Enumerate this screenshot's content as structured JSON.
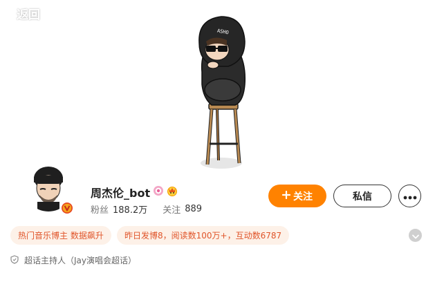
{
  "header": {
    "back_label": "返回",
    "back_icon": "chevron-left-icon"
  },
  "profile": {
    "name": "周杰伦_bot",
    "followers_label": "粉丝",
    "followers_value": "188.2万",
    "following_label": "关注",
    "following_value": "889",
    "badges": [
      "music-badge-icon",
      "crown-badge-icon"
    ],
    "verified_icon": "verified-v-icon"
  },
  "actions": {
    "follow_label": "关注",
    "follow_icon": "plus-icon",
    "message_label": "私信",
    "more_icon": "more-dots-icon"
  },
  "tags": [
    {
      "label": "热门音乐博主 数据飙升"
    },
    {
      "label": "昨日发博8，阅读数100万+，互动数6787"
    }
  ],
  "role": {
    "icon": "shield-icon",
    "label": "超话主持人（Jay演唱会超话）"
  },
  "colors": {
    "accent": "#ff8200",
    "tag_bg": "#fdf1e8",
    "tag_text": "#e0552a"
  }
}
